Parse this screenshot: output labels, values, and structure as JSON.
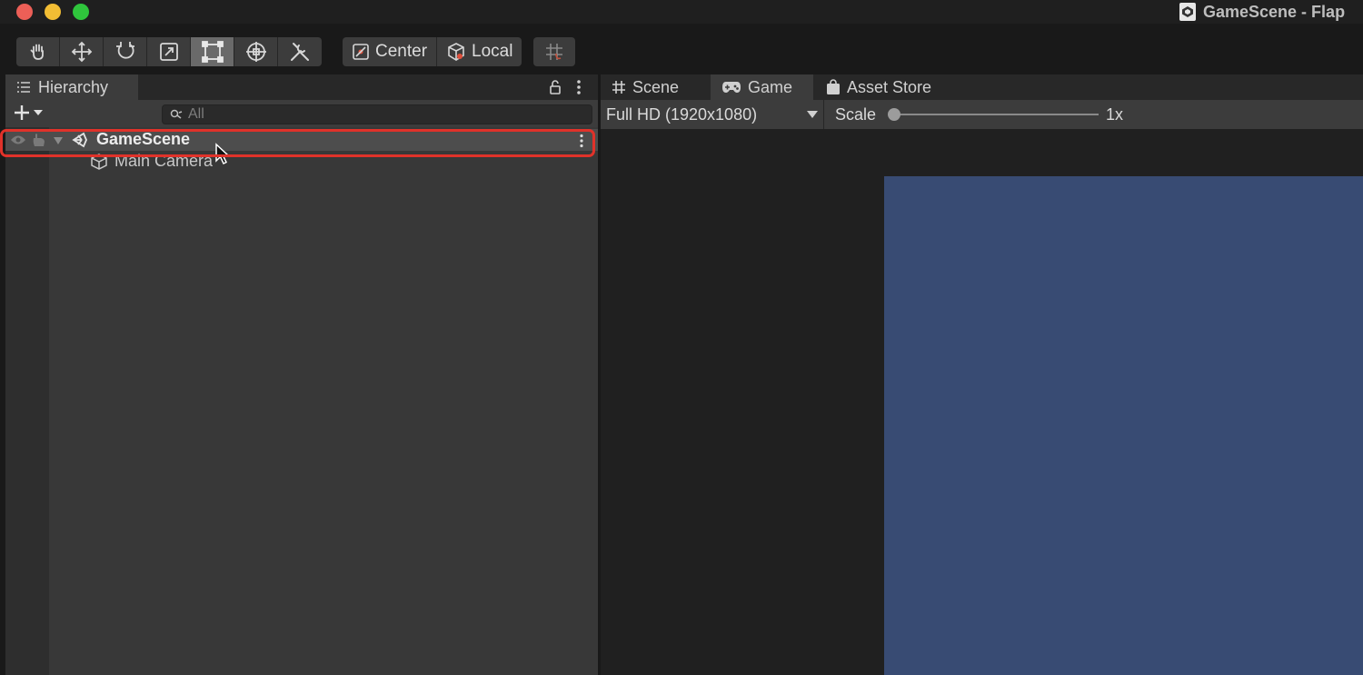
{
  "window": {
    "title": "GameScene - Flap"
  },
  "toolbar": {
    "tools": [
      "hand-tool",
      "move-tool",
      "rotate-tool",
      "scale-tool",
      "rect-tool",
      "transform-tool",
      "custom-editor-tool"
    ],
    "pivot_mode_label": "Center",
    "pivot_rotation_label": "Local"
  },
  "hierarchy": {
    "tab_label": "Hierarchy",
    "search_placeholder": "All",
    "scene_name": "GameScene",
    "children": [
      "Main Camera"
    ]
  },
  "game_view": {
    "tabs": [
      {
        "label": "Scene",
        "icon": "grid-icon"
      },
      {
        "label": "Game",
        "icon": "gamepad-icon"
      },
      {
        "label": "Asset Store",
        "icon": "shopping-bag-icon"
      }
    ],
    "active_tab": "Game",
    "resolution": "Full HD (1920x1080)",
    "scale_label": "Scale",
    "scale_value": "1x",
    "background_color": "#384b73"
  },
  "colors": {
    "highlight": "#e0322a",
    "selected_row": "#4d4d4d"
  }
}
